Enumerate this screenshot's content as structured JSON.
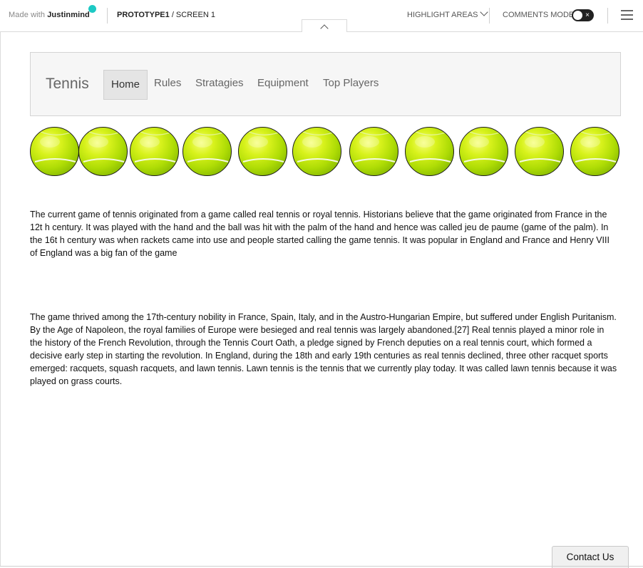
{
  "topbar": {
    "made_with": "Made with",
    "brand": "Justinmind",
    "prototype": "PROTOTYPE1",
    "screen": " / SCREEN 1",
    "highlight_areas": "HIGHLIGHT AREAS",
    "comments_mode": "COMMENTS MODE",
    "toggle_x": "×",
    "colors": {
      "brand_dot": "#1dc9c4"
    }
  },
  "nav": {
    "brand": "Tennis",
    "items": [
      {
        "label": "Home",
        "active": true
      },
      {
        "label": "Rules"
      },
      {
        "label": "Stratagies"
      },
      {
        "label": "Equipment"
      },
      {
        "label": "Top Players"
      }
    ]
  },
  "balls": {
    "count": 11,
    "icon": "tennis-ball-icon"
  },
  "content": {
    "paragraph1": "The current game of tennis originated from a game called real tennis or royal tennis. Historians believe that the game originated from France in the 12t  h  century. It was played with the hand and the ball was hit with the palm of the hand and hence was called jeu de paume (game of the palm). In the 16t  h  century was when rackets came into use and people started calling the game tennis. It was popular in England and France and Henry VIII of England was a big fan of the game",
    "paragraph2": "The game thrived among the 17th-century nobility in France, Spain, Italy, and in the Austro-Hungarian Empire, but suffered under English Puritanism. By the Age of Napoleon, the royal families of Europe were besieged and real tennis was largely abandoned.[27] Real tennis played a minor role in the history of the French Revolution, through the Tennis Court Oath, a pledge signed by French deputies on a real tennis court, which formed a decisive early step in starting the revolution. In England, during the 18th and early 19th centuries as real tennis declined, three other racquet sports emerged: racquets, squash racquets, and lawn tennis. Lawn tennis is the tennis that we currently play today. It was called lawn tennis because it was played on grass courts."
  },
  "contact": {
    "label": "Contact Us"
  }
}
